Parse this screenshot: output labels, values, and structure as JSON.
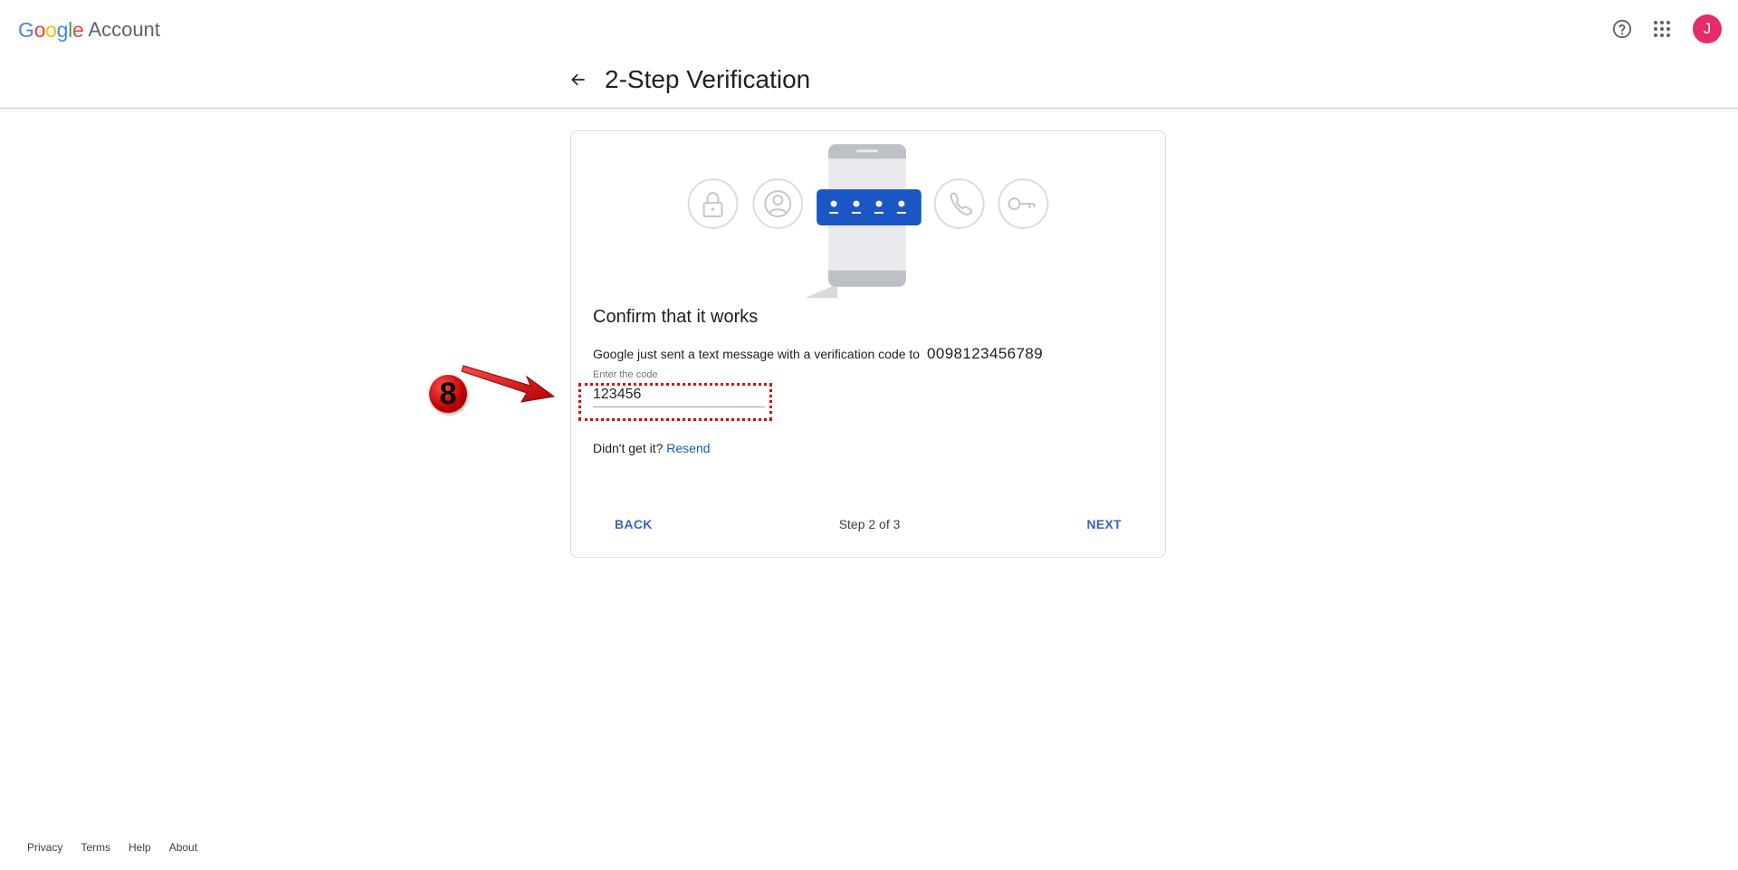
{
  "header": {
    "logo_text": "Google",
    "logo_suffix": "Account",
    "help_icon": "help-circle-icon",
    "apps_icon": "apps-grid-icon",
    "avatar_initial": "J",
    "avatar_color": "#e52b6a"
  },
  "page": {
    "title": "2-Step Verification",
    "back_icon": "arrow-back-icon"
  },
  "card": {
    "illustration_icons": [
      "lock-icon",
      "account-circle-icon",
      "phone-code-icon",
      "phone-call-icon",
      "key-icon"
    ],
    "heading": "Confirm that it works",
    "description": "Google just sent a text message with a verification code to",
    "phone_number": "0098123456789",
    "code_label": "Enter the code",
    "code_value": "123456",
    "resend_prompt": "Didn't get it?",
    "resend_link": "Resend",
    "back_button": "BACK",
    "step_indicator": "Step 2 of 3",
    "next_button": "NEXT"
  },
  "annotation": {
    "step_number": "8"
  },
  "footer": {
    "links": [
      "Privacy",
      "Terms",
      "Help",
      "About"
    ]
  },
  "colors": {
    "accent": "#1a73e8",
    "button_text": "#3b63c6",
    "annotation": "#e00000"
  }
}
